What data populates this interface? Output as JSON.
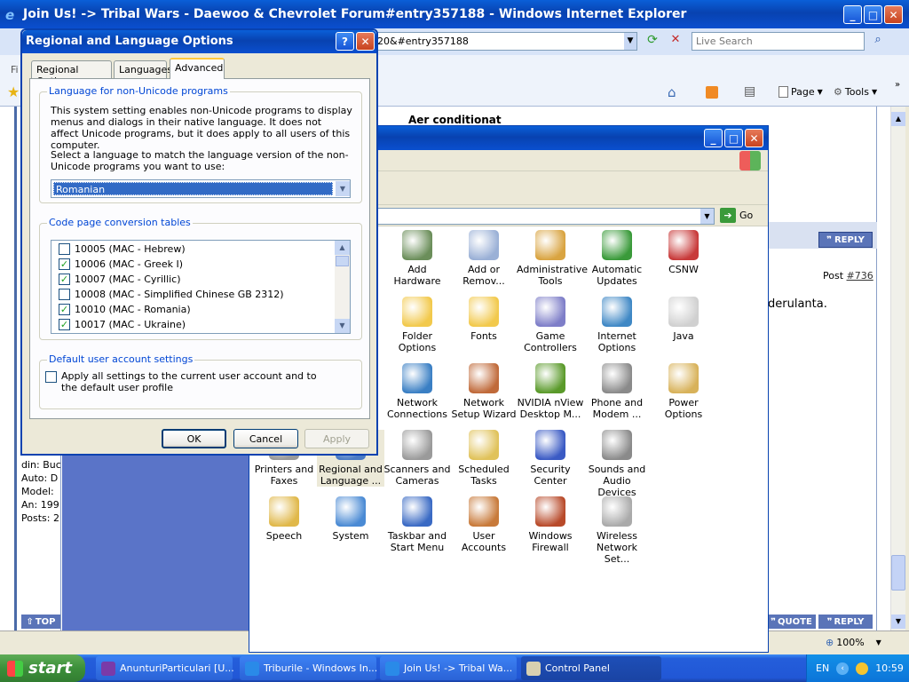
{
  "ie": {
    "title": "Join Us! -> Tribal Wars - Daewoo & Chevrolet Forum#entry357188 - Windows Internet Explorer",
    "address_fragment": "20&#entry357188",
    "search_placeholder": "Live Search",
    "page_menu": "Page",
    "tools_menu": "Tools",
    "zoom": "100%",
    "fi_label": "Fi"
  },
  "forum": {
    "heading": "Aer conditionat",
    "reply_label": "REPLY",
    "post_prefix": "Post",
    "post_link": "#736",
    "body_fragment": "derulanta.",
    "profile_lines": [
      "din: Buc",
      "Auto: D",
      "Model:",
      "An: 199",
      "Posts: 2"
    ],
    "top_label": "TOP",
    "quote_label": "QUOTE",
    "reply_bottom": "REPLY"
  },
  "control_panel": {
    "go_label": "Go",
    "items": [
      {
        "label": "Add Hardware",
        "icon": "add-hardware-icon",
        "color": "#6b8e5a"
      },
      {
        "label": "Add or Remov...",
        "icon": "add-remove-programs-icon",
        "color": "#9ab0d6"
      },
      {
        "label": "Administrative Tools",
        "icon": "administrative-tools-icon",
        "color": "#d9a441"
      },
      {
        "label": "Automatic Updates",
        "icon": "automatic-updates-icon",
        "color": "#3a9a3a"
      },
      {
        "label": "CSNW",
        "icon": "csnw-icon",
        "color": "#c83a3a"
      },
      {
        "label": "Folder Options",
        "icon": "folder-options-icon",
        "color": "#f2c94c"
      },
      {
        "label": "Fonts",
        "icon": "fonts-icon",
        "color": "#f2c94c"
      },
      {
        "label": "Game Controllers",
        "icon": "game-controllers-icon",
        "color": "#7e7ec8"
      },
      {
        "label": "Internet Options",
        "icon": "internet-options-icon",
        "color": "#3f88c5"
      },
      {
        "label": "Java",
        "icon": "java-icon",
        "color": "#d0d0d0"
      },
      {
        "label": "Network Connections",
        "icon": "network-connections-icon",
        "color": "#3a7fc4"
      },
      {
        "label": "Network Setup Wizard",
        "icon": "network-setup-wizard-icon",
        "color": "#c06a3a"
      },
      {
        "label": "NVIDIA nView Desktop M...",
        "icon": "nvidia-nview-icon",
        "color": "#5a9a2a"
      },
      {
        "label": "Phone and Modem ...",
        "icon": "phone-modem-icon",
        "color": "#8a8a8a"
      },
      {
        "label": "Power Options",
        "icon": "power-options-icon",
        "color": "#d8b25a"
      },
      {
        "label": "Printers and Faxes",
        "icon": "printers-faxes-icon",
        "color": "#9a9a9a"
      },
      {
        "label": "Regional and Language ...",
        "icon": "regional-language-icon",
        "color": "#4a7ac4"
      },
      {
        "label": "Scanners and Cameras",
        "icon": "scanners-cameras-icon",
        "color": "#9a9a9a"
      },
      {
        "label": "Scheduled Tasks",
        "icon": "scheduled-tasks-icon",
        "color": "#e0c25a"
      },
      {
        "label": "Security Center",
        "icon": "security-center-icon",
        "color": "#3a5ac4"
      },
      {
        "label": "Sounds and Audio Devices",
        "icon": "sounds-audio-icon",
        "color": "#8a8a8a"
      },
      {
        "label": "Speech",
        "icon": "speech-icon",
        "color": "#e0b84a"
      },
      {
        "label": "System",
        "icon": "system-icon",
        "color": "#4a8ad4"
      },
      {
        "label": "Taskbar and Start Menu",
        "icon": "taskbar-start-menu-icon",
        "color": "#3a6ac4"
      },
      {
        "label": "User Accounts",
        "icon": "user-accounts-icon",
        "color": "#c87a3a"
      },
      {
        "label": "Windows Firewall",
        "icon": "windows-firewall-icon",
        "color": "#b84a2a"
      },
      {
        "label": "Wireless Network Set...",
        "icon": "wireless-network-icon",
        "color": "#aaaaaa"
      }
    ]
  },
  "dialog": {
    "title": "Regional and Language Options",
    "tabs": [
      "Regional Options",
      "Languages",
      "Advanced"
    ],
    "active_tab": "Advanced",
    "nonunicode_legend": "Language for non-Unicode programs",
    "nonunicode_desc": "This system setting enables non-Unicode programs to display menus and dialogs in their native language. It does not affect Unicode programs, but it does apply to all users of this computer.",
    "select_prompt": "Select a language to match the language version of the non-Unicode programs you want to use:",
    "selected_language": "Romanian",
    "codepage_legend": "Code page conversion tables",
    "codepages": [
      {
        "label": "10005 (MAC - Hebrew)",
        "checked": false
      },
      {
        "label": "10006 (MAC - Greek I)",
        "checked": true
      },
      {
        "label": "10007 (MAC - Cyrillic)",
        "checked": true
      },
      {
        "label": "10008 (MAC - Simplified Chinese GB 2312)",
        "checked": false
      },
      {
        "label": "10010 (MAC - Romania)",
        "checked": true
      },
      {
        "label": "10017 (MAC - Ukraine)",
        "checked": true
      }
    ],
    "default_legend": "Default user account settings",
    "default_checkbox": "Apply all settings to the current user account and to the default user profile",
    "ok": "OK",
    "cancel": "Cancel",
    "apply": "Apply",
    "help_symbol": "?",
    "close_symbol": "✕"
  },
  "taskbar": {
    "start": "start",
    "tasks": [
      "AnunturiParticulari [U...",
      "Triburile - Windows In...",
      "Join Us! -> Tribal Wa...",
      "Control Panel"
    ],
    "lang": "EN",
    "clock": "10:59"
  }
}
